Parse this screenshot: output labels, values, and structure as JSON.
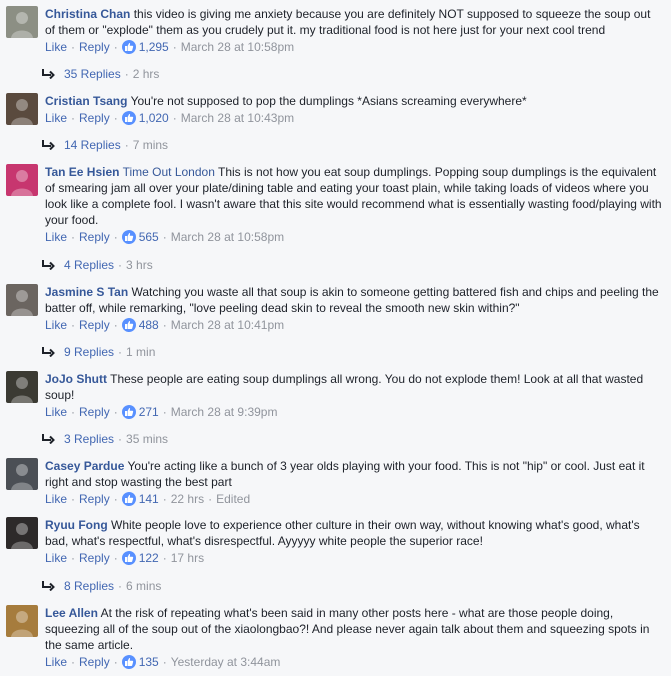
{
  "labels": {
    "like": "Like",
    "reply": "Reply"
  },
  "comments": [
    {
      "author": "Christina Chan",
      "tag": "",
      "text": "this video is giving me anxiety because you are definitely NOT supposed to squeeze the soup out of them or \"explode\" them as you crudely put it. my traditional food is not here just for your next cool trend",
      "likes": "1,295",
      "time": "March 28 at 10:58pm",
      "edited": "",
      "replies": "35 Replies",
      "replies_time": "2 hrs",
      "avatar_color": "#8c8f84"
    },
    {
      "author": "Cristian Tsang",
      "tag": "",
      "text": "You're not supposed to pop the dumplings *Asians screaming everywhere*",
      "likes": "1,020",
      "time": "March 28 at 10:43pm",
      "edited": "",
      "replies": "14 Replies",
      "replies_time": "7 mins",
      "avatar_color": "#5a4a3e"
    },
    {
      "author": "Tan Ee Hsien",
      "tag": "Time Out London",
      "text": "This is not how you eat soup dumplings. Popping soup dumplings is the equivalent of smearing jam all over your plate/dining table and eating your toast plain, while taking loads of videos where you look like a complete fool. I wasn't aware that this site would recommend what is essentially wasting food/playing with your food.",
      "likes": "565",
      "time": "March 28 at 10:58pm",
      "edited": "",
      "replies": "4 Replies",
      "replies_time": "3 hrs",
      "avatar_color": "#c7366f"
    },
    {
      "author": "Jasmine S Tan",
      "tag": "",
      "text": "Watching you waste all that soup is akin to someone getting battered fish and chips and peeling the batter off, while remarking, \"love peeling dead skin to reveal the smooth new skin within?\"",
      "likes": "488",
      "time": "March 28 at 10:41pm",
      "edited": "",
      "replies": "9 Replies",
      "replies_time": "1 min",
      "avatar_color": "#6b6560"
    },
    {
      "author": "JoJo Shutt",
      "tag": "",
      "text": "These people are eating soup dumplings all wrong. You do not explode them! Look at all that wasted soup!",
      "likes": "271",
      "time": "March 28 at 9:39pm",
      "edited": "",
      "replies": "3 Replies",
      "replies_time": "35 mins",
      "avatar_color": "#3b3a33"
    },
    {
      "author": "Casey Pardue",
      "tag": "",
      "text": "You're acting like a bunch of 3 year olds playing with your food. This is not \"hip\" or cool. Just eat it right and stop wasting the best part",
      "likes": "141",
      "time": "22 hrs",
      "edited": "Edited",
      "replies": "",
      "replies_time": "",
      "avatar_color": "#4b4f55"
    },
    {
      "author": "Ryuu Fong",
      "tag": "",
      "text": "White people love to experience other culture in their own way, without knowing what's good, what's bad, what's respectful, what's disrespectful. Ayyyyy white people the superior race!",
      "likes": "122",
      "time": "17 hrs",
      "edited": "",
      "replies": "8 Replies",
      "replies_time": "6 mins",
      "avatar_color": "#2d2a2a"
    },
    {
      "author": "Lee Allen",
      "tag": "",
      "text": "At the risk of repeating what's been said in many other posts here - what are those people doing, squeezing all of the soup out of the xiaolongbao?! And please never again talk about them and squeezing spots in the same article.",
      "likes": "135",
      "time": "Yesterday at 3:44am",
      "edited": "",
      "replies": "",
      "replies_time": "",
      "avatar_color": "#a67c3d"
    }
  ]
}
